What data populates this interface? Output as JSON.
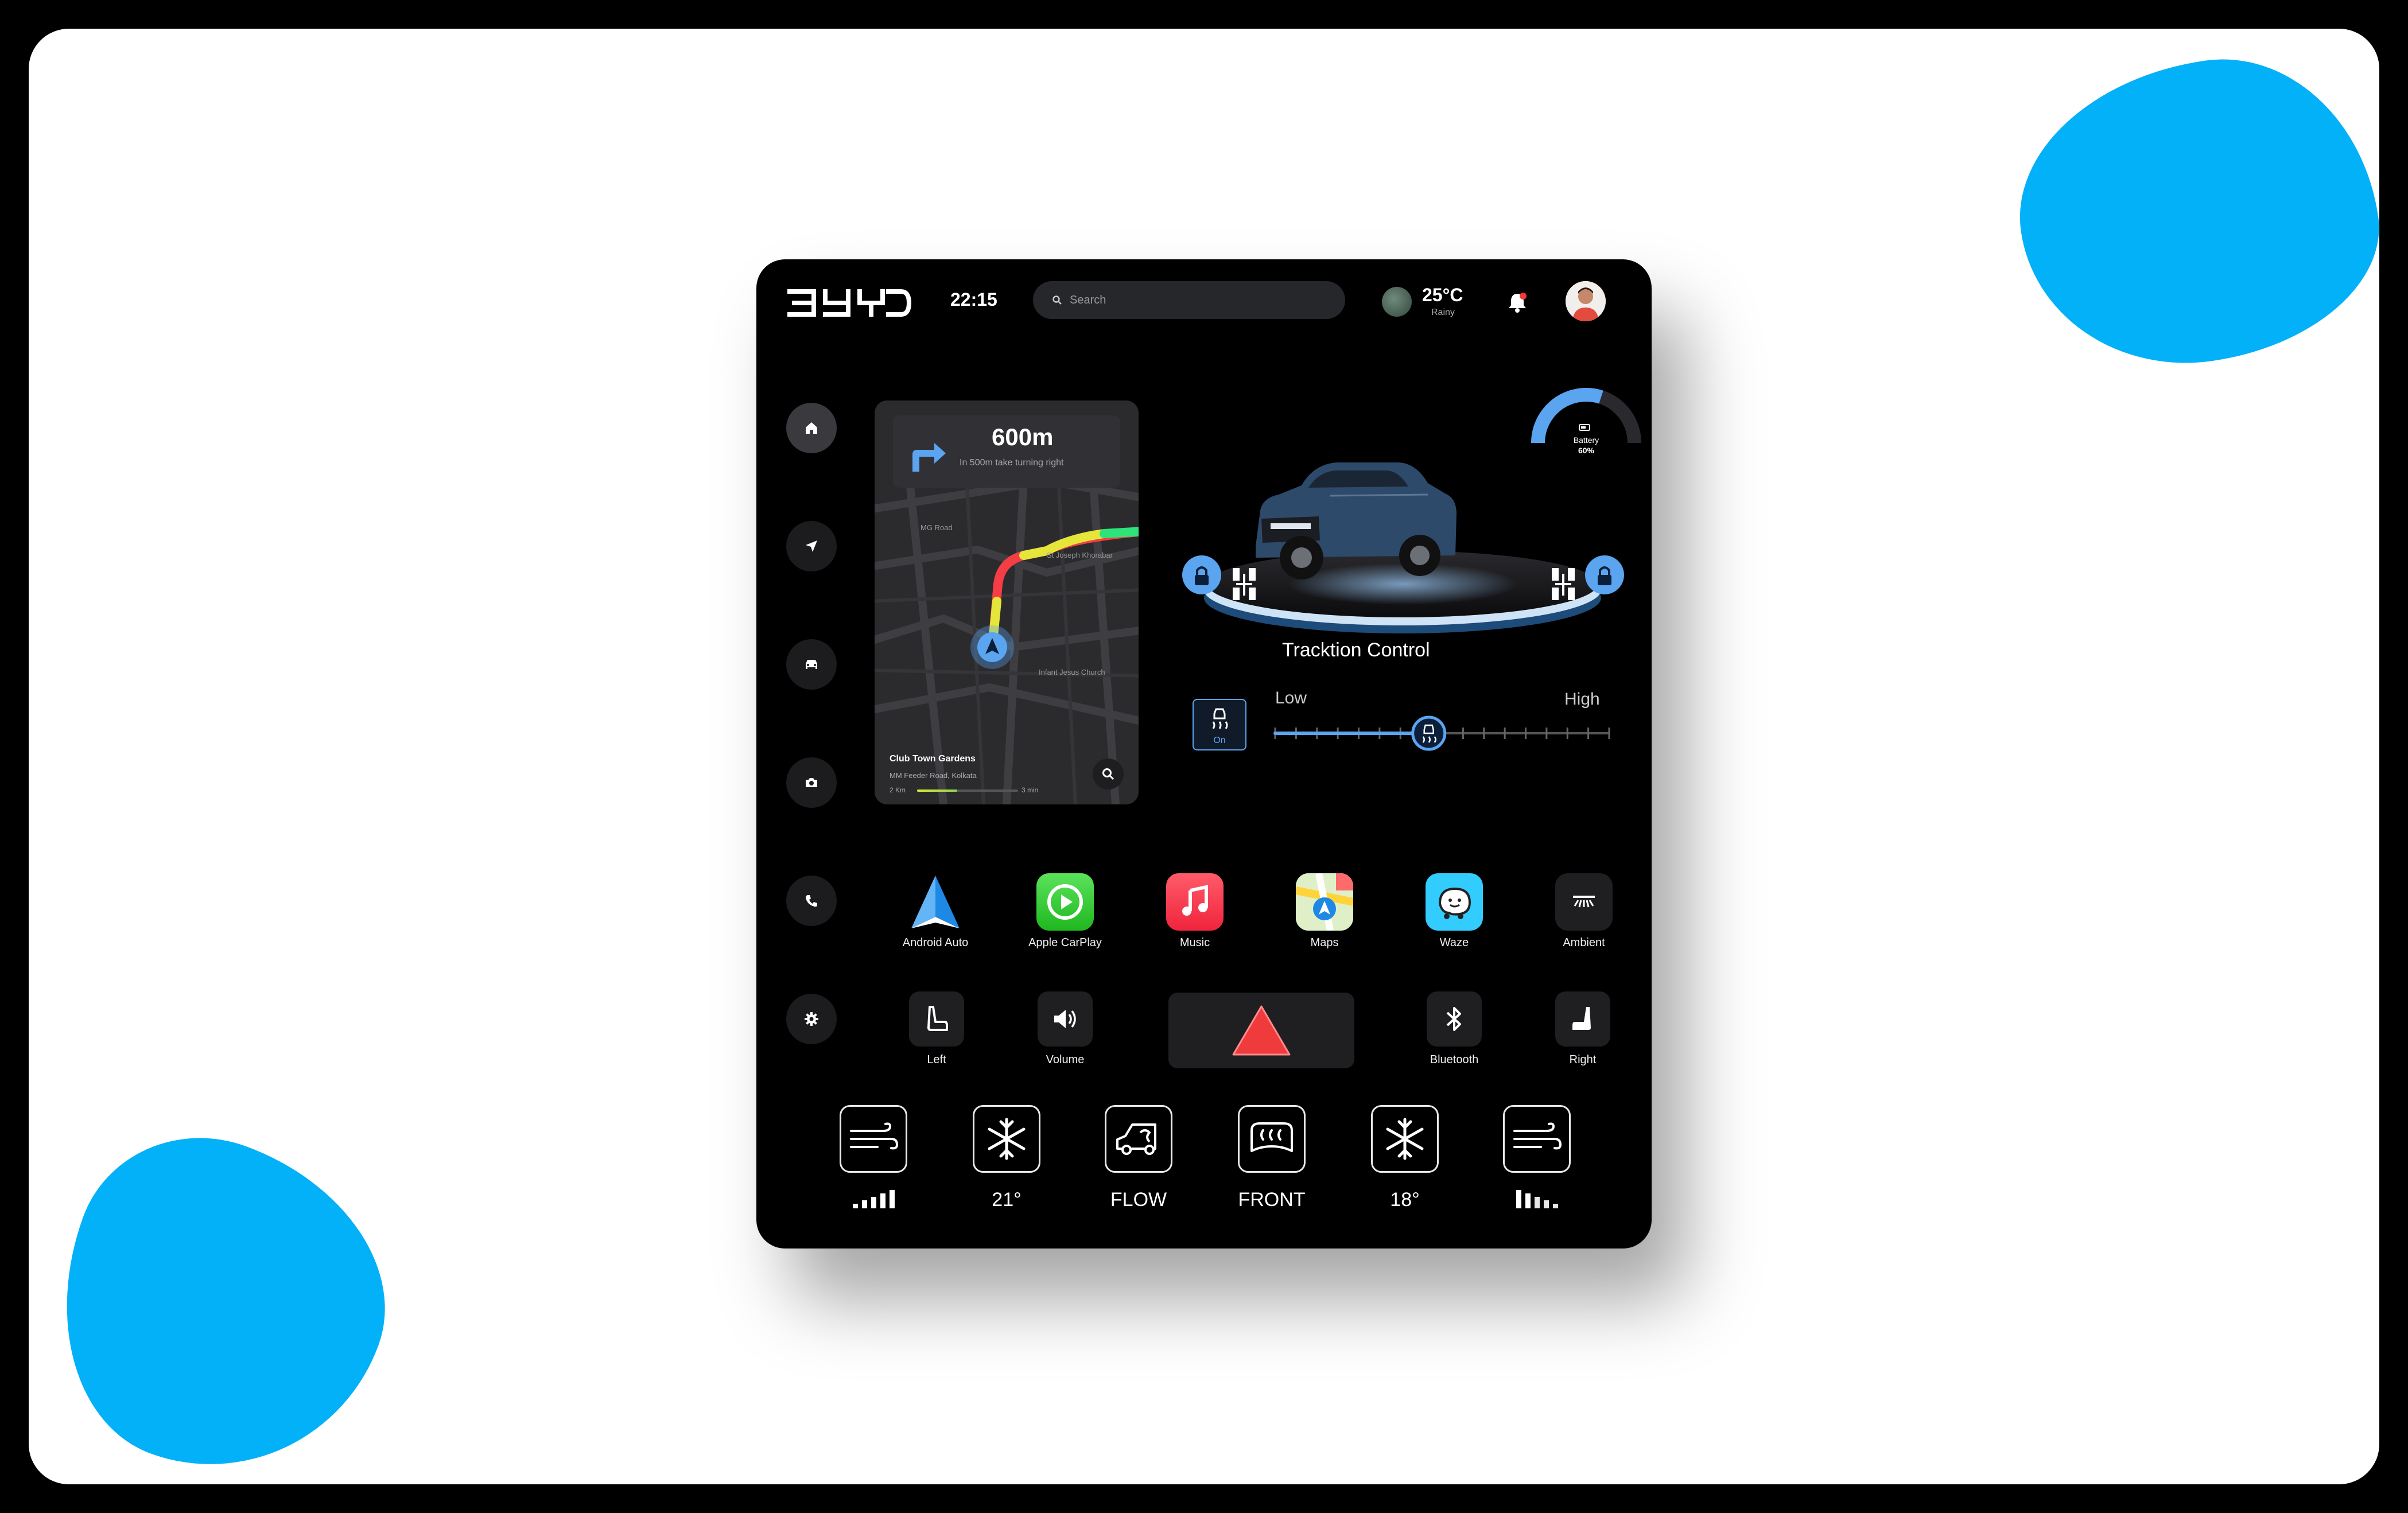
{
  "brand": {
    "logo_text": "BYD",
    "accent_color": "#5aa4f0",
    "blob_color": "#02b1f7"
  },
  "header": {
    "time": "22:15",
    "search_placeholder": "Search",
    "temperature": "25°C",
    "condition": "Rainy"
  },
  "sidebar": {
    "items": [
      {
        "icon": "home-icon",
        "active": true
      },
      {
        "icon": "navigation-icon"
      },
      {
        "icon": "car-icon"
      },
      {
        "icon": "camera-icon"
      },
      {
        "icon": "phone-icon"
      },
      {
        "icon": "settings-icon"
      }
    ]
  },
  "navigation": {
    "distance": "600m",
    "instruction": "In 500m take turning right",
    "map_labels": [
      "MG Road",
      "St Joseph Khorabar",
      "Infant Jesus Church"
    ],
    "destination": "Club Town Gardens",
    "address": "MM Feeder Road, Kolkata",
    "remaining_distance": "2 Km",
    "eta": "3 min",
    "progress": 0.4
  },
  "vehicle": {
    "battery_label": "Battery",
    "battery_value": "60%",
    "battery_level": 0.6
  },
  "traction": {
    "title": "Tracktion Control",
    "toggle_label": "On",
    "low_label": "Low",
    "high_label": "High",
    "level": 0.46
  },
  "apps": [
    {
      "label": "Android Auto",
      "icon": "android-auto-icon"
    },
    {
      "label": "Apple CarPlay",
      "icon": "apple-carplay-icon"
    },
    {
      "label": "Music",
      "icon": "music-icon"
    },
    {
      "label": "Maps",
      "icon": "maps-icon"
    },
    {
      "label": "Waze",
      "icon": "waze-icon"
    },
    {
      "label": "Ambient",
      "icon": "ambient-light-icon"
    }
  ],
  "controls": [
    {
      "label": "Left",
      "icon": "seat-left-icon"
    },
    {
      "label": "Volume",
      "icon": "volume-icon"
    },
    {
      "label": "Bluetooth",
      "icon": "bluetooth-icon"
    },
    {
      "label": "Right",
      "icon": "seat-right-icon"
    }
  ],
  "hazard": {
    "icon": "hazard-icon",
    "color": "#ef3b3b"
  },
  "climate": [
    {
      "label": "",
      "icon": "fan-left-icon",
      "level": 5
    },
    {
      "label": "21°",
      "icon": "snowflake-left-icon"
    },
    {
      "label": "FLOW",
      "icon": "airflow-icon"
    },
    {
      "label": "FRONT",
      "icon": "front-defrost-icon"
    },
    {
      "label": "18°",
      "icon": "snowflake-right-icon"
    },
    {
      "label": "",
      "icon": "fan-right-icon",
      "level": 2
    }
  ]
}
